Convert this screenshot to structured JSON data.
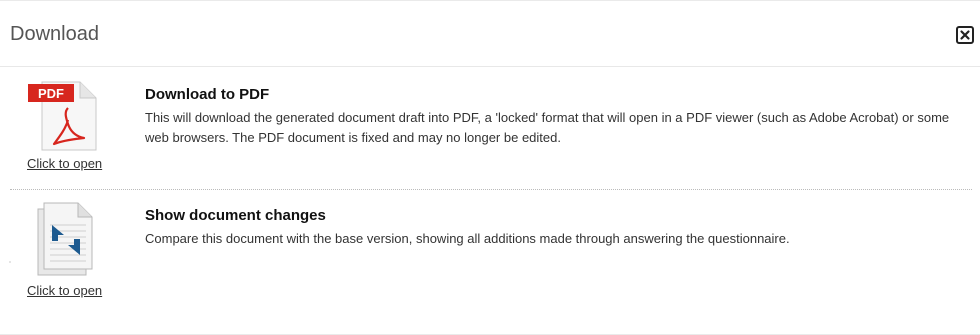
{
  "dialog": {
    "title": "Download",
    "close_label": "Close"
  },
  "options": [
    {
      "title": "Download to PDF",
      "description": "This will download the generated document draft into PDF, a 'locked' format that will open in a PDF viewer (such as Adobe Acrobat) or some web browsers. The PDF document is fixed and may no longer be edited.",
      "link_label": "Click to open",
      "icon": "pdf-file-icon",
      "badge": "PDF"
    },
    {
      "title": "Show document changes",
      "description": "Compare this document with the base version, showing all additions made through answering the questionnaire.",
      "link_label": "Click to open",
      "icon": "compare-document-icon"
    }
  ],
  "colors": {
    "pdf_red": "#d7261e",
    "compare_blue": "#1d5a8f"
  }
}
